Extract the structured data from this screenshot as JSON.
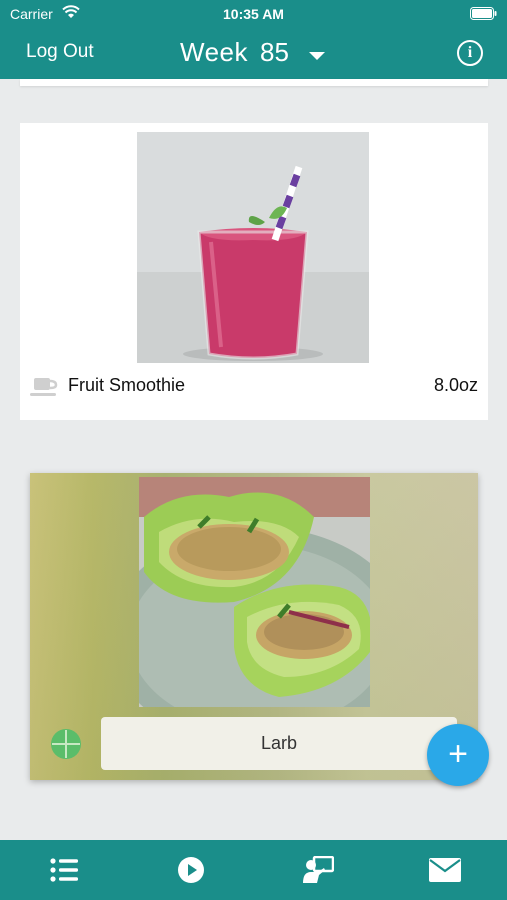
{
  "status_bar": {
    "carrier": "Carrier",
    "time": "10:35 AM"
  },
  "nav": {
    "logout_label": "Log Out",
    "week_label": "Week",
    "week_number": "85",
    "info_glyph": "i"
  },
  "meals": [
    {
      "name": "Fruit Smoothie",
      "amount": "8.0oz",
      "icon": "cup-icon"
    },
    {
      "name": "Larb",
      "icon": "plate-icon"
    }
  ],
  "fab": {
    "label": "+"
  },
  "tabs": [
    {
      "icon": "list-icon"
    },
    {
      "icon": "play-icon"
    },
    {
      "icon": "presenter-icon"
    },
    {
      "icon": "mail-icon"
    }
  ],
  "colors": {
    "teal": "#1a8e8a",
    "fab": "#2aa8e8"
  }
}
